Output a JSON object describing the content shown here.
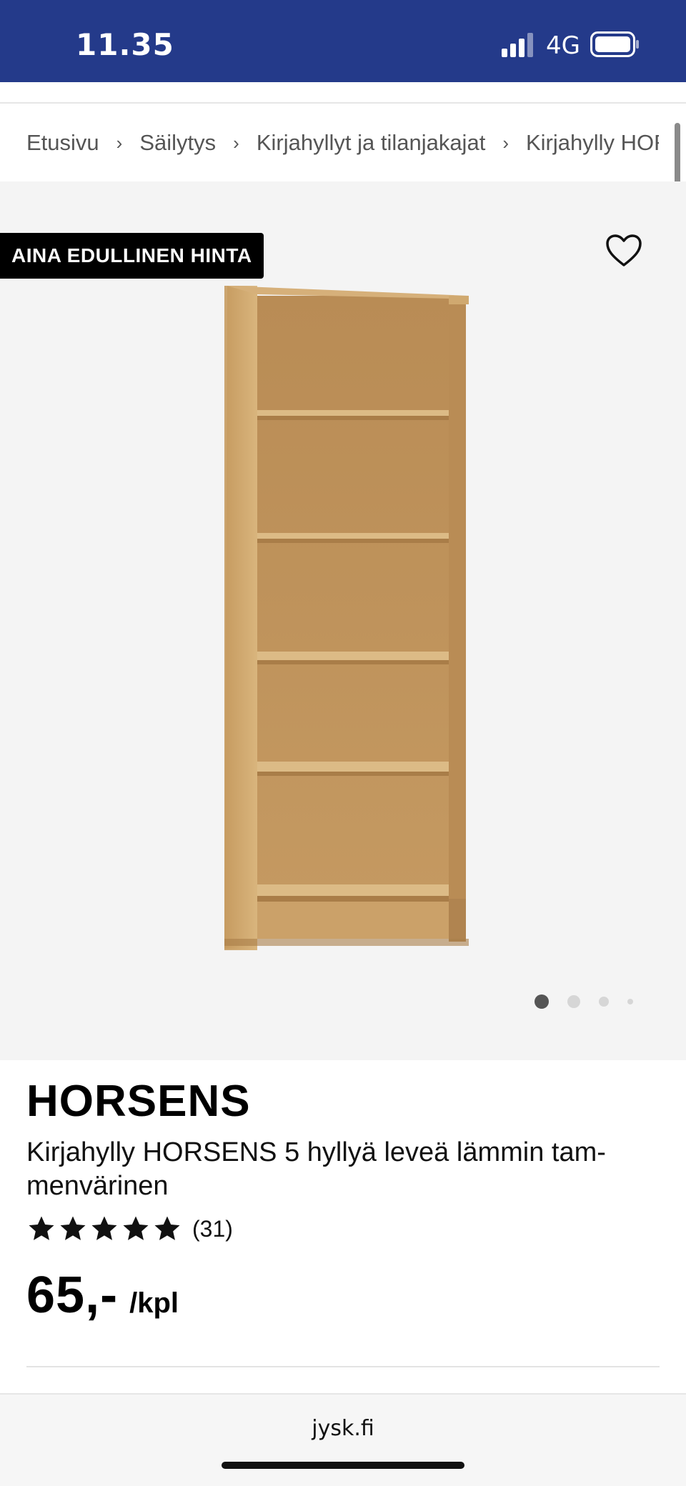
{
  "status_bar": {
    "time": "11.35",
    "network": "4G"
  },
  "breadcrumb": {
    "items": [
      "Etusivu",
      "Säilytys",
      "Kirjahyllyt ja tilanjakajat",
      "Kirjahylly HORSENS"
    ]
  },
  "badge": "AINA EDULLINEN HINTA",
  "product": {
    "name": "HORSENS",
    "description": "Kirjahylly HORSENS 5 hyllyä leveä lämmin tam-menvärinen",
    "rating": 5,
    "review_count": "(31)",
    "price": "65,-",
    "unit": "/kpl"
  },
  "gallery": {
    "image_count": 4,
    "active_index": 1
  },
  "browser": {
    "url": "jysk.fi"
  },
  "colors": {
    "status_bar": "#243a8a",
    "badge": "#000000",
    "gallery_bg": "#f4f4f4",
    "wood": "#c9a26a"
  }
}
